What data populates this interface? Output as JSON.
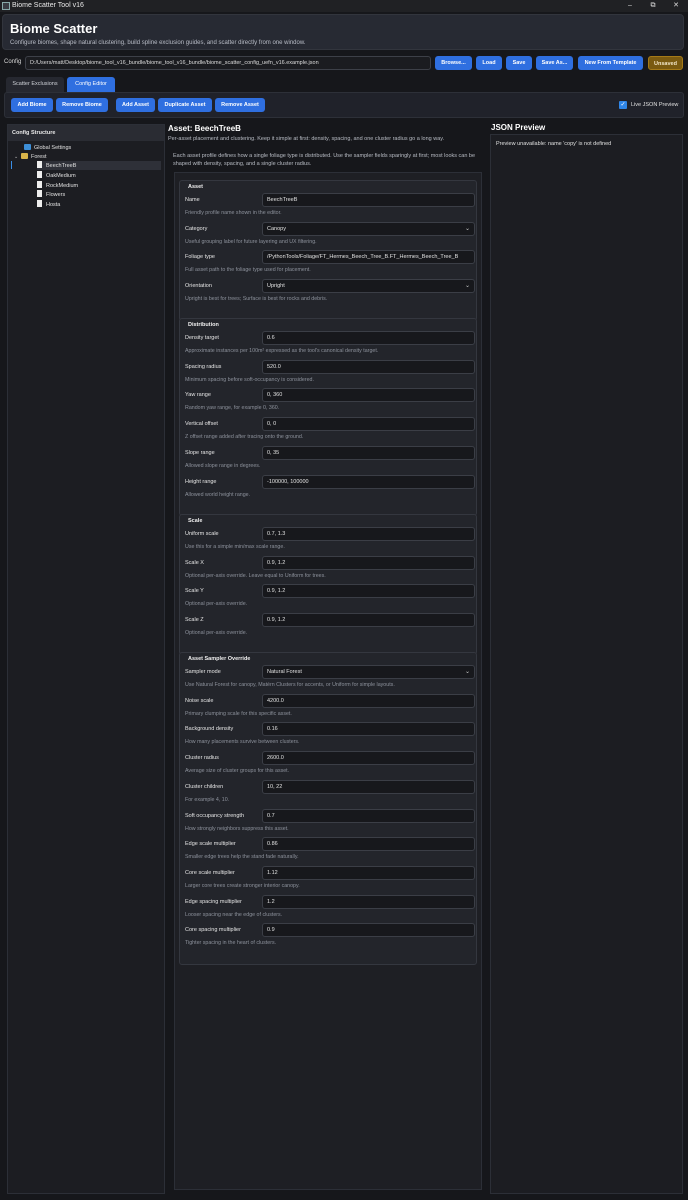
{
  "window": {
    "title": "Biome Scatter Tool v16",
    "min": "–",
    "max": "⧉",
    "close": "✕"
  },
  "header": {
    "title": "Biome Scatter",
    "subtitle": "Configure biomes, shape natural clustering, build spline exclusion guides, and scatter directly from one window."
  },
  "config": {
    "label": "Config",
    "path": "D:/Users/matt/Desktop/biome_tool_v16_bundle/biome_tool_v16_bundle/biome_scatter_config_uefn_v16.example.json",
    "browse": "Browse...",
    "load": "Load",
    "save": "Save",
    "save_as": "Save As...",
    "new_from_template": "New From Template",
    "status": "Unsaved"
  },
  "tabs": [
    "Scatter  Exclusions",
    "Config Editor"
  ],
  "toolbar": {
    "add_biome": "Add Biome",
    "remove_biome": "Remove Biome",
    "add_asset": "Add Asset",
    "duplicate_asset": "Duplicate Asset",
    "remove_asset": "Remove Asset",
    "live_preview": "Live JSON Preview",
    "live_preview_checked": true
  },
  "tree": {
    "header": "Config Structure",
    "global": "Global Settings",
    "biome": "Forest",
    "assets": [
      "BeechTreeB",
      "OakMedium",
      "RockMedium",
      "Flowers",
      "Hosta"
    ],
    "selected": "BeechTreeB"
  },
  "main": {
    "title": "Asset: BeechTreeB",
    "desc1": "Per-asset placement and clustering. Keep it simple at first: density, spacing, and one cluster radius go a long way.",
    "desc2": "Each asset profile defines how a single foliage type is distributed. Use the sampler fields sparingly at first; most looks can be shaped with density, spacing, and a single cluster radius.",
    "sections": [
      {
        "title": "Asset",
        "fields": [
          {
            "label": "Name",
            "value": "BeechTreeB",
            "help": "Friendly profile name shown in the editor.",
            "select": false
          },
          {
            "label": "Category",
            "value": "Canopy",
            "help": "Useful grouping label for future layering and UX filtering.",
            "select": true
          },
          {
            "label": "Foliage type",
            "value": "/PythonTools/Foliage/FT_Hermes_Beech_Tree_B.FT_Hermes_Beech_Tree_B",
            "help": "Full asset path to the foliage type used for placement.",
            "select": false
          },
          {
            "label": "Orientation",
            "value": "Upright",
            "help": "Upright is best for trees; Surface is best for rocks and debris.",
            "select": true
          }
        ]
      },
      {
        "title": "Distribution",
        "fields": [
          {
            "label": "Density target",
            "value": "0.6",
            "help": "Approximate instances per 100m² expressed as the tool's canonical density target.",
            "select": false
          },
          {
            "label": "Spacing radius",
            "value": "520.0",
            "help": "Minimum spacing before soft-occupancy is considered.",
            "select": false
          },
          {
            "label": "Yaw range",
            "value": "0, 360",
            "help": "Random yaw range, for example 0, 360.",
            "select": false
          },
          {
            "label": "Vertical offset",
            "value": "0, 0",
            "help": "Z offset range added after tracing onto the ground.",
            "select": false
          },
          {
            "label": "Slope range",
            "value": "0, 35",
            "help": "Allowed slope range in degrees.",
            "select": false
          },
          {
            "label": "Height range",
            "value": "-100000, 100000",
            "help": "Allowed world height range.",
            "select": false
          }
        ]
      },
      {
        "title": "Scale",
        "fields": [
          {
            "label": "Uniform scale",
            "value": "0.7, 1.3",
            "help": "Use this for a simple min/max scale range.",
            "select": false
          },
          {
            "label": "Scale X",
            "value": "0.9, 1.2",
            "help": "Optional per-axis override. Leave equal to Uniform for trees.",
            "select": false
          },
          {
            "label": "Scale Y",
            "value": "0.9, 1.2",
            "help": "Optional per-axis override.",
            "select": false
          },
          {
            "label": "Scale Z",
            "value": "0.9, 1.2",
            "help": "Optional per-axis override.",
            "select": false
          }
        ]
      },
      {
        "title": "Asset Sampler Override",
        "fields": [
          {
            "label": "Sampler mode",
            "value": "Natural Forest",
            "help": "Use Natural Forest for canopy, Matérn Clusters for accents, or Uniform for simple layouts.",
            "select": true
          },
          {
            "label": "Noise scale",
            "value": "4200.0",
            "help": "Primary clumping scale for this specific asset.",
            "select": false
          },
          {
            "label": "Background density",
            "value": "0.16",
            "help": "How many placements survive between clusters.",
            "select": false
          },
          {
            "label": "Cluster radius",
            "value": "2600.0",
            "help": "Average size of cluster groups for this asset.",
            "select": false
          },
          {
            "label": "Cluster children",
            "value": "10, 22",
            "help": "For example 4, 10.",
            "select": false
          },
          {
            "label": "Soft occupancy strength",
            "value": "0.7",
            "help": "How strongly neighbors suppress this asset.",
            "select": false
          },
          {
            "label": "Edge scale multiplier",
            "value": "0.86",
            "help": "Smaller edge trees help the stand fade naturally.",
            "select": false
          },
          {
            "label": "Core scale multiplier",
            "value": "1.12",
            "help": "Larger core trees create stronger interior canopy.",
            "select": false
          },
          {
            "label": "Edge spacing multiplier",
            "value": "1.2",
            "help": "Looser spacing near the edge of clusters.",
            "select": false
          },
          {
            "label": "Core spacing multiplier",
            "value": "0.9",
            "help": "Tighter spacing in the heart of clusters.",
            "select": false
          }
        ]
      }
    ]
  },
  "json_preview": {
    "title": "JSON Preview",
    "text": "Preview unavailable: name 'copy' is not defined"
  },
  "colors": {
    "accent": "#2f6fe0",
    "background": "#16171b",
    "unsaved": "#7a5a10"
  }
}
